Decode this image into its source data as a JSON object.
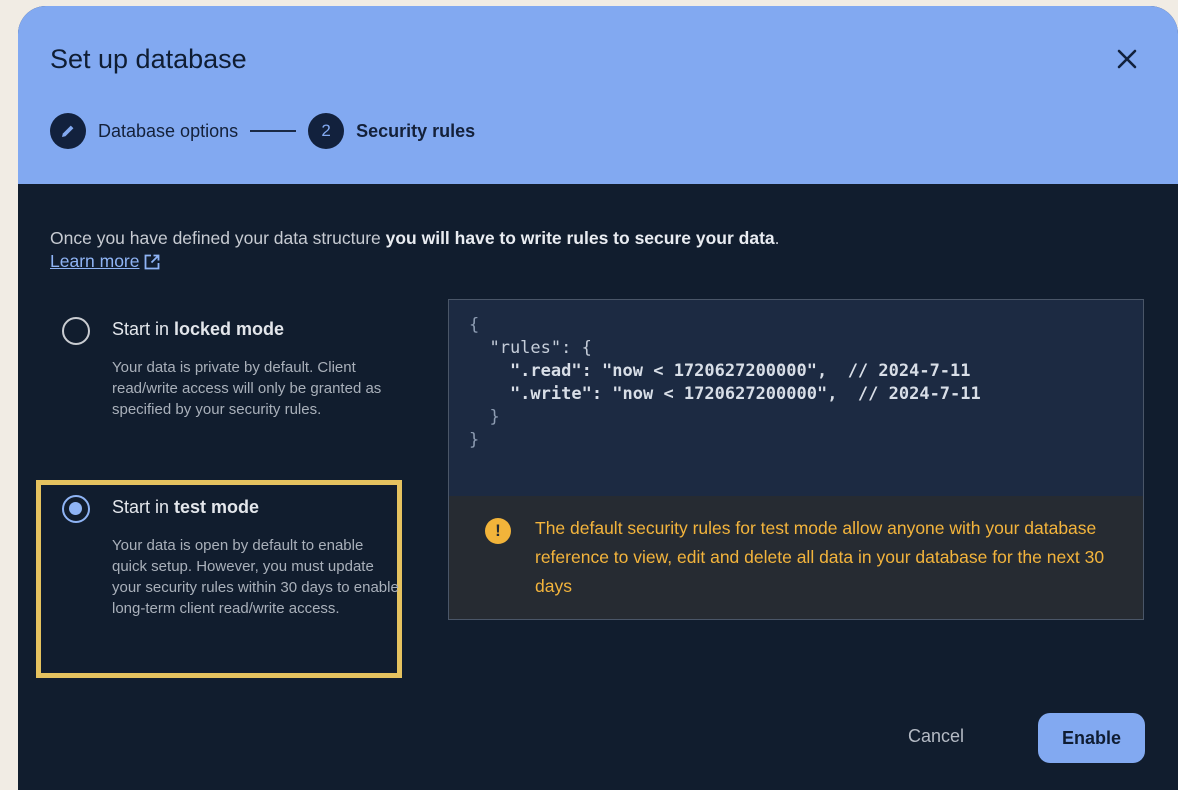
{
  "dialog": {
    "title": "Set up database",
    "close_icon": "close-icon"
  },
  "stepper": {
    "step1": {
      "label": "Database options",
      "icon": "pencil-icon",
      "state": "completed"
    },
    "step2": {
      "number": "2",
      "label": "Security rules",
      "state": "active"
    }
  },
  "intro": {
    "text_plain": "Once you have defined your data structure ",
    "text_bold": "you will have to write rules to secure your data",
    "text_end": ".",
    "learn_more": "Learn more"
  },
  "options": {
    "locked": {
      "title_prefix": "Start in ",
      "title_bold": "locked mode",
      "description": "Your data is private by default. Client read/write access will only be granted as specified by your security rules.",
      "selected": false
    },
    "test": {
      "title_prefix": "Start in ",
      "title_bold": "test mode",
      "description": "Your data is open by default to enable quick setup. However, you must update your security rules within 30 days to enable long-term client read/write access.",
      "selected": true
    }
  },
  "code": {
    "line1": "{",
    "line2": "  \"rules\": {",
    "line3": "    \".read\": \"now < 1720627200000\",  // 2024-7-11",
    "line4": "    \".write\": \"now < 1720627200000\",  // 2024-7-11",
    "line5": "  }",
    "line6": "}"
  },
  "warning": {
    "icon": "warning-icon",
    "text": "The default security rules for test mode allow anyone with your database reference to view, edit and delete all data in your database for the next 30 days"
  },
  "actions": {
    "cancel": "Cancel",
    "enable": "Enable"
  },
  "colors": {
    "header_bg": "#82a9f1",
    "dialog_bg": "#111d2e",
    "highlight": "#e5c25f",
    "warning_text": "#f3b43c"
  }
}
